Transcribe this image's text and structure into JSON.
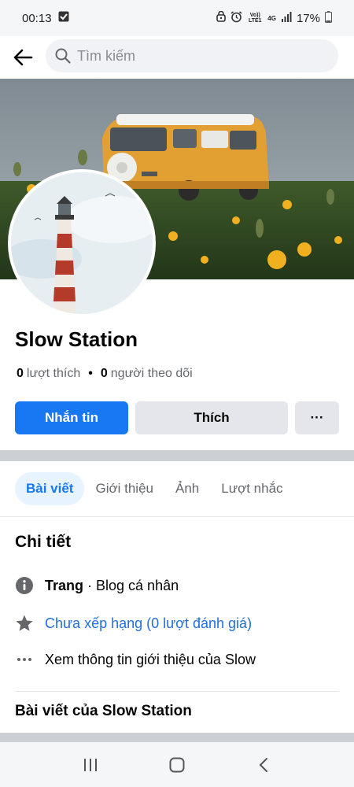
{
  "status_bar": {
    "time": "00:13",
    "battery_percent": "17%",
    "network_label": "4G",
    "carrier_label": "Vo)) LTE1",
    "icons": [
      "checkbox-notification-icon",
      "alarm-clock-icon",
      "cell-signal-icon",
      "battery-icon"
    ]
  },
  "search": {
    "placeholder": "Tìm kiếm",
    "value": ""
  },
  "profile": {
    "name": "Slow Station",
    "likes_count": "0",
    "likes_label": "lượt thích",
    "followers_count": "0",
    "followers_label": "người theo dõi"
  },
  "actions": {
    "message_label": "Nhắn tin",
    "like_label": "Thích",
    "more_label": "···"
  },
  "tabs": [
    {
      "label": "Bài viết",
      "active": true
    },
    {
      "label": "Giới thiệu",
      "active": false
    },
    {
      "label": "Ảnh",
      "active": false
    },
    {
      "label": "Lượt nhắc",
      "active": false
    }
  ],
  "details": {
    "title": "Chi tiết",
    "category_type": "Trang",
    "category_sep": " · ",
    "category_value": "Blog cá nhân",
    "rating_text": "Chưa xếp hạng (0 lượt đánh giá)",
    "about_text": "Xem thông tin giới thiệu của Slow"
  },
  "posts_section": {
    "title": "Bài viết của Slow Station"
  },
  "colors": {
    "accent": "#1877f2",
    "link": "#216fdb",
    "secondary_button": "#e4e6eb",
    "separator": "#ccd0d5"
  }
}
